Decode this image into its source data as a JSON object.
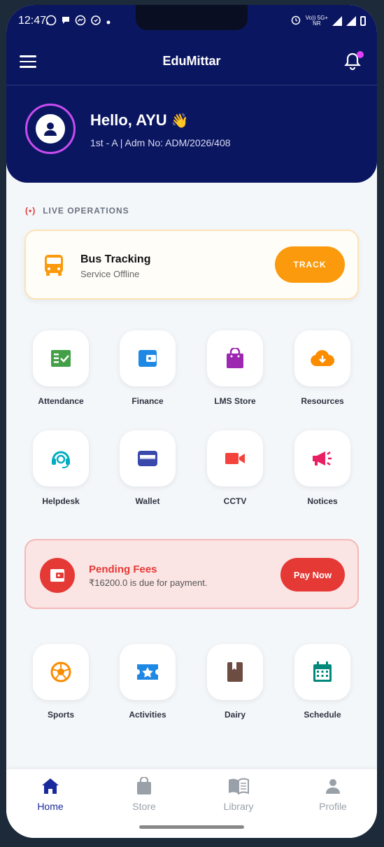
{
  "status": {
    "time": "12:47",
    "network_top": "Vo)) 5G+",
    "network_bot": "NR"
  },
  "app": {
    "title": "EduMittar"
  },
  "user": {
    "greeting": "Hello, AYU",
    "wave": "👋",
    "info": "1st - A | Adm No: ADM/2026/408"
  },
  "live": {
    "label": "LIVE OPERATIONS",
    "icon": "(•)"
  },
  "bus": {
    "title": "Bus Tracking",
    "status": "Service Offline",
    "button": "TRACK"
  },
  "tiles_row1": [
    {
      "label": "Attendance",
      "icon": "attendance-icon",
      "color": "#43a047"
    },
    {
      "label": "Finance",
      "icon": "wallet-icon",
      "color": "#1e88e5"
    },
    {
      "label": "LMS Store",
      "icon": "shopping-bag-icon",
      "color": "#9c27b0"
    },
    {
      "label": "Resources",
      "icon": "cloud-download-icon",
      "color": "#fb8c00"
    }
  ],
  "tiles_row2": [
    {
      "label": "Helpdesk",
      "icon": "headset-icon",
      "color": "#00acc1"
    },
    {
      "label": "Wallet",
      "icon": "card-icon",
      "color": "#3949ab"
    },
    {
      "label": "CCTV",
      "icon": "video-camera-icon",
      "color": "#f4433c"
    },
    {
      "label": "Notices",
      "icon": "megaphone-icon",
      "color": "#e91e63"
    }
  ],
  "fees": {
    "title": "Pending Fees",
    "message": "₹16200.0 is due for payment.",
    "button": "Pay Now"
  },
  "tiles_row3": [
    {
      "label": "Sports",
      "icon": "soccer-ball-icon",
      "color": "#fb8c00"
    },
    {
      "label": "Activities",
      "icon": "star-ticket-icon",
      "color": "#1e88e5"
    },
    {
      "label": "Dairy",
      "icon": "book-icon",
      "color": "#6d4c41"
    },
    {
      "label": "Schedule",
      "icon": "calendar-icon",
      "color": "#00897b"
    }
  ],
  "nav": [
    {
      "label": "Home",
      "icon": "home-icon",
      "active": true
    },
    {
      "label": "Store",
      "icon": "store-bag-icon",
      "active": false
    },
    {
      "label": "Library",
      "icon": "open-book-icon",
      "active": false
    },
    {
      "label": "Profile",
      "icon": "person-icon",
      "active": false
    }
  ]
}
